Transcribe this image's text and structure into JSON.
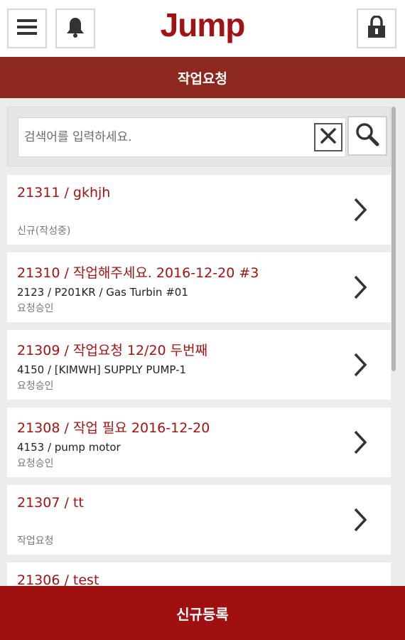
{
  "header": {
    "logo": "Jump",
    "menu_icon": "hamburger-menu-icon",
    "bell_icon": "bell-icon",
    "lock_icon": "lock-icon"
  },
  "title": "작업요청",
  "search": {
    "placeholder": "검색어를 입력하세요.",
    "value": "",
    "clear_icon": "close-icon",
    "search_icon": "magnifier-icon"
  },
  "items": [
    {
      "title": "21311 / gkhjh",
      "subtitle": "",
      "status": "신규(작성중)"
    },
    {
      "title": "21310 / 작업해주세요. 2016-12-20 #3",
      "subtitle": "2123 / P201KR / Gas Turbin #01",
      "status": "요청승인"
    },
    {
      "title": "21309 / 작업요청 12/20 두번째",
      "subtitle": "4150 / [KIMWH] SUPPLY PUMP-1",
      "status": "요청승인"
    },
    {
      "title": "21308 / 작업 필요 2016-12-20",
      "subtitle": "4153 / pump motor",
      "status": "요청승인"
    },
    {
      "title": "21307 / tt",
      "subtitle": "",
      "status": "작업요청"
    },
    {
      "title": "21306 / test",
      "subtitle": "",
      "status": ""
    }
  ],
  "bottom_button": "신규등록",
  "colors": {
    "brand_red": "#a31212",
    "title_bar": "#8d281e",
    "bottom_bar": "#a01010"
  }
}
